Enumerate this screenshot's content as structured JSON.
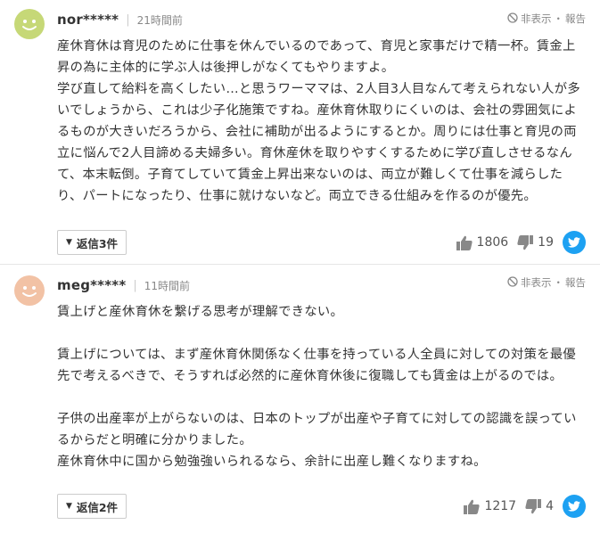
{
  "comments": [
    {
      "username": "nor*****",
      "time": "21時間前",
      "hide_label": "非表示",
      "report_label": "報告",
      "paragraphs": [
        "産休育休は育児のために仕事を休んでいるのであって、育児と家事だけで精一杯。賃金上昇の為に主体的に学ぶ人は後押しがなくてもやりますよ。",
        "学び直して給料を高くしたい…と思うワーママは、2人目3人目なんて考えられない人が多いでしょうから、これは少子化施策ですね。産休育休取りにくいのは、会社の雰囲気によるものが大きいだろうから、会社に補助が出るようにするとか。周りには仕事と育児の両立に悩んで2人目諦める夫婦多い。育休産休を取りやすくするために学び直しさせるなんて、本末転倒。子育てしていて賃金上昇出来ないのは、両立が難しくて仕事を減らしたり、パートになったり、仕事に就けないなど。両立できる仕組みを作るのが優先。"
      ],
      "reply_label": "返信3件",
      "likes": "1806",
      "dislikes": "19",
      "avatar_color": "#c6d877"
    },
    {
      "username": "meg*****",
      "time": "11時間前",
      "hide_label": "非表示",
      "report_label": "報告",
      "paragraphs": [
        "賃上げと産休育休を繋げる思考が理解できない。",
        "",
        "賃上げについては、まず産休育休関係なく仕事を持っている人全員に対しての対策を最優先で考えるべきで、そうすれば必然的に産休育休後に復職しても賃金は上がるのでは。",
        "",
        "子供の出産率が上がらないのは、日本のトップが出産や子育てに対しての認識を誤っているからだと明確に分かりました。",
        "産休育休中に国から勉強強いられるなら、余計に出産し難くなりますね。"
      ],
      "reply_label": "返信2件",
      "likes": "1217",
      "dislikes": "4",
      "avatar_color": "#f2c2a5"
    }
  ],
  "colors": {
    "twitter": "#1da1f2",
    "muted": "#888888",
    "text": "#333333"
  },
  "icons": [
    "smiley-avatar-icon",
    "ban-icon",
    "thumbs-up-icon",
    "thumbs-down-icon",
    "twitter-icon",
    "triangle-down-icon"
  ]
}
